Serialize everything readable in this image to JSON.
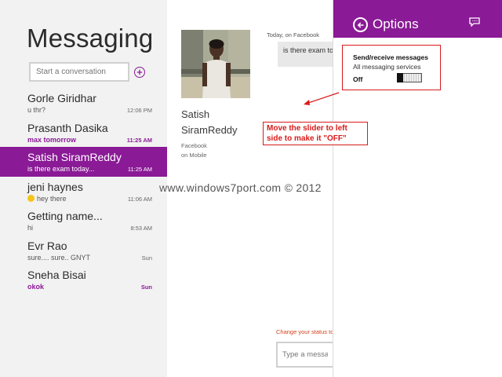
{
  "app": {
    "title": "Messaging",
    "search_placeholder": "Start a conversation"
  },
  "conversations": [
    {
      "name": "Gorle Giridhar",
      "preview": "u thr?",
      "time": "12:06 PM",
      "state": "normal"
    },
    {
      "name": "Prasanth Dasika",
      "preview": "max tomorrow",
      "time": "11:25 AM",
      "state": "unread"
    },
    {
      "name": "Satish SiramReddy",
      "preview": "is there exam today...",
      "time": "11:25 AM",
      "state": "selected"
    },
    {
      "name": "jeni haynes",
      "preview": "hey there",
      "time": "11:06 AM",
      "state": "normal",
      "emoji": "smiley-icon"
    },
    {
      "name": "Getting name...",
      "preview": "hi",
      "time": "8:53 AM",
      "state": "normal"
    },
    {
      "name": "Evr Rao",
      "preview": "sure.... sure.. GNYT",
      "time": "Sun",
      "state": "normal"
    },
    {
      "name": "Sneha Bisai",
      "preview": "okok",
      "time": "Sun",
      "state": "unread"
    }
  ],
  "contact": {
    "first_name": "Satish",
    "last_name": "SiramReddy",
    "source_line1": "Facebook",
    "source_line2": "on Mobile"
  },
  "thread": {
    "meta": "Today, on Facebook",
    "message": "is there exam to",
    "status_link": "Change your status to",
    "input_placeholder": "Type a message"
  },
  "options": {
    "title": "Options",
    "setting_title": "Send/receive messages",
    "setting_sub": "All messaging services",
    "state_label": "Off",
    "toggle_on": false
  },
  "annotation": {
    "text": "Move the slider to left side to make it \"OFF\""
  },
  "watermark": "www.windows7port.com © 2012",
  "colors": {
    "accent": "#8a1a96",
    "annotation_red": "#d81b1b",
    "status_orange": "#d2431d"
  }
}
